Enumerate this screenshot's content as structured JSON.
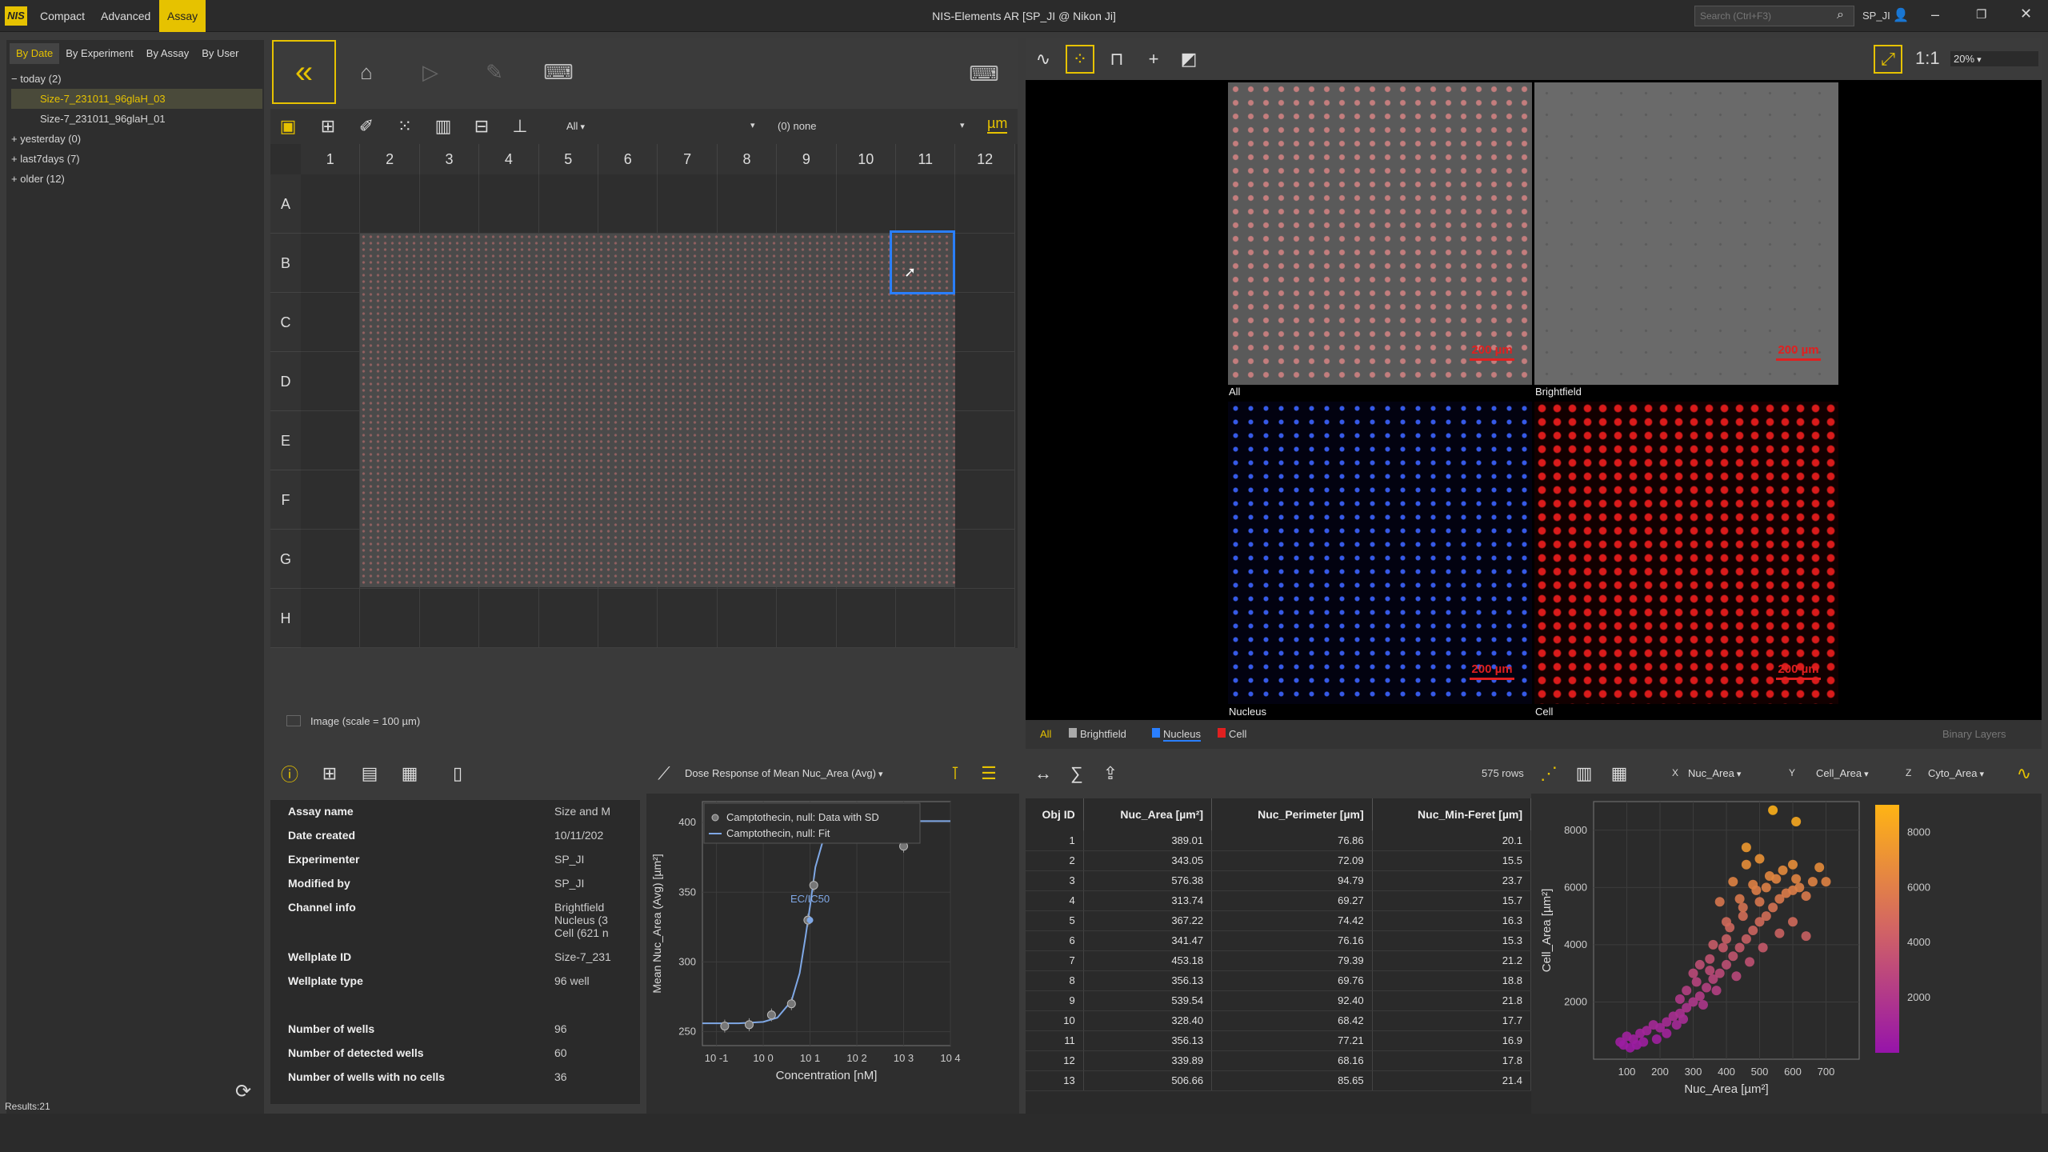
{
  "app": {
    "logo": "NIS",
    "menu": [
      "Compact",
      "Advanced",
      "Assay"
    ],
    "window_title": "NIS-Elements AR [SP_JI @ Nikon Ji]",
    "search_placeholder": "Search (Ctrl+F3)",
    "user": "SP_JI"
  },
  "left": {
    "tabs": [
      "By Date",
      "By Experiment",
      "By Assay",
      "By User"
    ],
    "tree": [
      {
        "label": "today (2)",
        "toggle": "−",
        "level": 0
      },
      {
        "label": "Size-7_231011_96glaH_03",
        "toggle": "",
        "level": 1,
        "selected": true
      },
      {
        "label": "Size-7_231011_96glaH_01",
        "toggle": "",
        "level": 1
      },
      {
        "label": "yesterday (0)",
        "toggle": "+",
        "level": 0
      },
      {
        "label": "last7days (7)",
        "toggle": "+",
        "level": 0
      },
      {
        "label": "older (12)",
        "toggle": "+",
        "level": 0
      }
    ],
    "results": "Results:21"
  },
  "plate": {
    "filter_all": "All",
    "filter_none": "(0) none",
    "unit": "µm",
    "cols": [
      "1",
      "2",
      "3",
      "4",
      "5",
      "6",
      "7",
      "8",
      "9",
      "10",
      "11",
      "12"
    ],
    "rows": [
      "A",
      "B",
      "C",
      "D",
      "E",
      "F",
      "G",
      "H"
    ],
    "image_scale_label": "Image (scale = 100 µm)"
  },
  "viewer": {
    "ratio": "1:1",
    "zoom": "20%",
    "scale_label": "200 µm",
    "panels": [
      "All",
      "Brightfield",
      "Nucleus",
      "Cell"
    ],
    "channel_tabs": [
      "All",
      "Brightfield",
      "Nucleus",
      "Cell"
    ],
    "channel_colors": [
      "#aaaaaa",
      "#2a7fff",
      "#e02020"
    ],
    "binary_layers": "Binary Layers"
  },
  "info": {
    "rows": [
      {
        "k": "Assay name",
        "v": "Size and M"
      },
      {
        "k": "Date created",
        "v": "10/11/202"
      },
      {
        "k": "Experimenter",
        "v": "SP_JI"
      },
      {
        "k": "Modified by",
        "v": "SP_JI"
      },
      {
        "k": "Channel info",
        "v": "Brightfield\nNucleus (3\nCell (621 n"
      },
      {
        "k": "Wellplate ID",
        "v": "Size-7_231"
      },
      {
        "k": "Wellplate type",
        "v": "96 well"
      },
      {
        "k": "",
        "v": ""
      },
      {
        "k": "Number of wells",
        "v": "96"
      },
      {
        "k": "Number of detected wells",
        "v": "60"
      },
      {
        "k": "Number of wells with no cells",
        "v": "36"
      }
    ]
  },
  "dose": {
    "title": "Dose Response of Mean Nuc_Area (Avg)",
    "legend": [
      "Camptothecin, null: Data with SD",
      "Camptothecin, null: Fit"
    ],
    "ec_label": "EC/IC50",
    "xlabel": "Concentration [nM]",
    "ylabel": "Mean Nuc_Area (Avg) [µm²]"
  },
  "objtable": {
    "rows_count": "575 rows",
    "headers": [
      "Obj ID",
      "Nuc_Area [µm²]",
      "Nuc_Perimeter [µm]",
      "Nuc_Min-Feret [µm]"
    ],
    "rows": [
      [
        "1",
        "389.01",
        "76.86",
        "20.1"
      ],
      [
        "2",
        "343.05",
        "72.09",
        "15.5"
      ],
      [
        "3",
        "576.38",
        "94.79",
        "23.7"
      ],
      [
        "4",
        "313.74",
        "69.27",
        "15.7"
      ],
      [
        "5",
        "367.22",
        "74.42",
        "16.3"
      ],
      [
        "6",
        "341.47",
        "76.16",
        "15.3"
      ],
      [
        "7",
        "453.18",
        "79.39",
        "21.2"
      ],
      [
        "8",
        "356.13",
        "69.76",
        "18.8"
      ],
      [
        "9",
        "539.54",
        "92.40",
        "21.8"
      ],
      [
        "10",
        "328.40",
        "68.42",
        "17.7"
      ],
      [
        "11",
        "356.13",
        "77.21",
        "16.9"
      ],
      [
        "12",
        "339.89",
        "68.16",
        "17.8"
      ],
      [
        "13",
        "506.66",
        "85.65",
        "21.4"
      ]
    ]
  },
  "scatter": {
    "x_select": "Nuc_Area",
    "y_select": "Cell_Area",
    "z_select": "Cyto_Area",
    "xlabel": "Nuc_Area [µm²]",
    "ylabel": "Cell_Area [µm²]",
    "colorbar_ticks": [
      "8000",
      "6000",
      "4000",
      "2000"
    ]
  },
  "chart_data": [
    {
      "type": "scatter",
      "title": "",
      "xlabel": "Concentration [nM]",
      "ylabel": "Mean Nuc_Area (Avg) [µm²]",
      "x_scale": "log",
      "xlim": [
        0.05,
        10000
      ],
      "ylim": [
        240,
        415
      ],
      "xticks": [
        "10^-1",
        "10^0",
        "10^1",
        "10^2",
        "10^3",
        "10^4"
      ],
      "yticks": [
        250,
        300,
        350,
        400
      ],
      "series": [
        {
          "name": "Camptothecin, null: Data with SD",
          "x": [
            0.15,
            0.5,
            1.5,
            4,
            9,
            12,
            300,
            1000
          ],
          "y": [
            254,
            255,
            262,
            270,
            330,
            355,
            397,
            383
          ]
        },
        {
          "name": "Camptothecin, null: Fit",
          "x": [
            0.05,
            0.3,
            1,
            2,
            4,
            6,
            8,
            10,
            13,
            20,
            40,
            100,
            1000,
            10000
          ],
          "y": [
            256,
            256,
            257,
            260,
            272,
            292,
            318,
            340,
            368,
            390,
            399,
            401,
            401,
            401
          ]
        }
      ],
      "annotations": [
        "EC/IC50"
      ]
    },
    {
      "type": "scatter",
      "xlabel": "Nuc_Area [µm²]",
      "ylabel": "Cell_Area [µm²]",
      "xlim": [
        0,
        800
      ],
      "ylim": [
        0,
        9000
      ],
      "xticks": [
        100,
        200,
        300,
        400,
        500,
        600,
        700
      ],
      "yticks": [
        2000,
        4000,
        6000,
        8000
      ],
      "color_by": "Cyto_Area",
      "colorbar_range": [
        0,
        9000
      ],
      "points": [
        [
          80,
          600
        ],
        [
          100,
          800
        ],
        [
          120,
          700
        ],
        [
          140,
          900
        ],
        [
          160,
          1000
        ],
        [
          180,
          1200
        ],
        [
          200,
          1100
        ],
        [
          220,
          1300
        ],
        [
          240,
          1500
        ],
        [
          260,
          1600
        ],
        [
          280,
          1800
        ],
        [
          300,
          2000
        ],
        [
          320,
          2200
        ],
        [
          340,
          2500
        ],
        [
          360,
          2800
        ],
        [
          380,
          3000
        ],
        [
          400,
          3300
        ],
        [
          420,
          3600
        ],
        [
          440,
          3900
        ],
        [
          460,
          4200
        ],
        [
          480,
          4500
        ],
        [
          500,
          4800
        ],
        [
          520,
          5000
        ],
        [
          540,
          5300
        ],
        [
          560,
          5600
        ],
        [
          580,
          5800
        ],
        [
          600,
          5900
        ],
        [
          620,
          6000
        ],
        [
          640,
          5700
        ],
        [
          660,
          6200
        ],
        [
          300,
          3000
        ],
        [
          350,
          3500
        ],
        [
          400,
          4200
        ],
        [
          450,
          5000
        ],
        [
          500,
          5500
        ],
        [
          550,
          6300
        ],
        [
          600,
          6800
        ],
        [
          380,
          5500
        ],
        [
          420,
          6200
        ],
        [
          460,
          6800
        ],
        [
          250,
          1200
        ],
        [
          270,
          1400
        ],
        [
          330,
          1900
        ],
        [
          370,
          2400
        ],
        [
          430,
          2900
        ],
        [
          470,
          3400
        ],
        [
          510,
          3900
        ],
        [
          560,
          4400
        ],
        [
          600,
          4800
        ],
        [
          640,
          4300
        ],
        [
          220,
          900
        ],
        [
          190,
          700
        ],
        [
          150,
          600
        ],
        [
          130,
          500
        ],
        [
          110,
          400
        ],
        [
          90,
          500
        ],
        [
          310,
          2700
        ],
        [
          350,
          3100
        ],
        [
          390,
          3900
        ],
        [
          410,
          4600
        ],
        [
          450,
          5300
        ],
        [
          490,
          5900
        ],
        [
          530,
          6400
        ],
        [
          570,
          6600
        ],
        [
          610,
          6300
        ],
        [
          680,
          6700
        ],
        [
          700,
          6200
        ],
        [
          540,
          8700
        ],
        [
          610,
          8300
        ],
        [
          260,
          2100
        ],
        [
          280,
          2400
        ],
        [
          320,
          3300
        ],
        [
          360,
          4000
        ],
        [
          400,
          4800
        ],
        [
          440,
          5600
        ],
        [
          480,
          6100
        ],
        [
          520,
          6000
        ],
        [
          500,
          7000
        ],
        [
          460,
          7400
        ]
      ]
    }
  ]
}
